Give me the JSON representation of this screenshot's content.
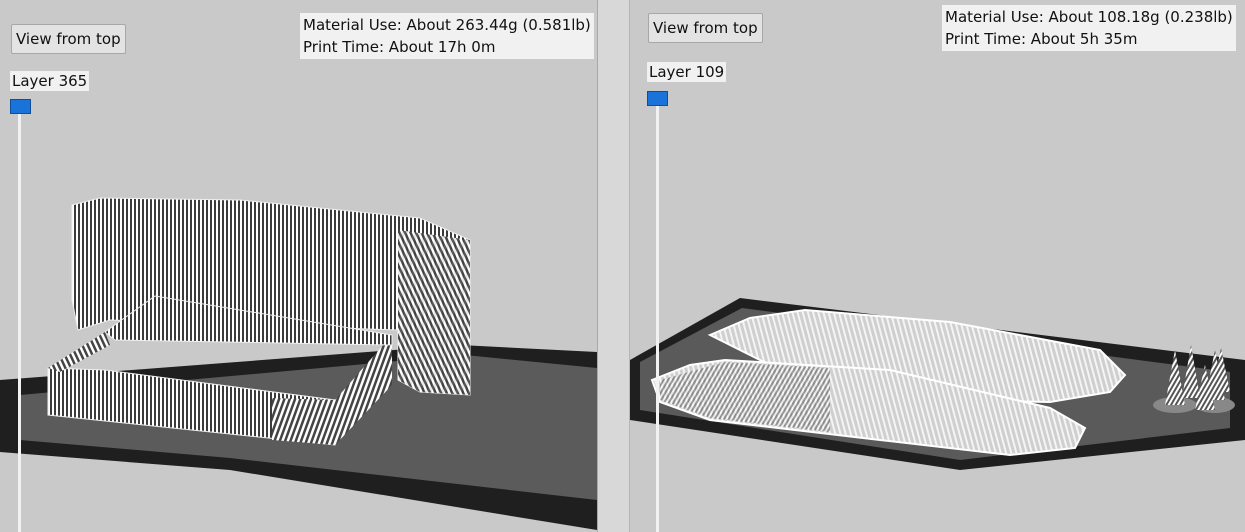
{
  "left_panel": {
    "view_button": "View from top",
    "material_use": "Material Use: About 263.44g (0.581lb)",
    "print_time": "Print Time: About 17h 0m",
    "layer_label": "Layer 365"
  },
  "right_panel": {
    "view_button": "View from top",
    "material_use": "Material Use: About 108.18g (0.238lb)",
    "print_time": "Print Time: About 5h 35m",
    "layer_label": "Layer 109"
  },
  "colors": {
    "background": "#c9c9c9",
    "build_plate": "#5a5a5a",
    "plate_edge": "#1f1f1f",
    "slider_handle": "#1a73d9",
    "print_lines": "#ffffff"
  }
}
